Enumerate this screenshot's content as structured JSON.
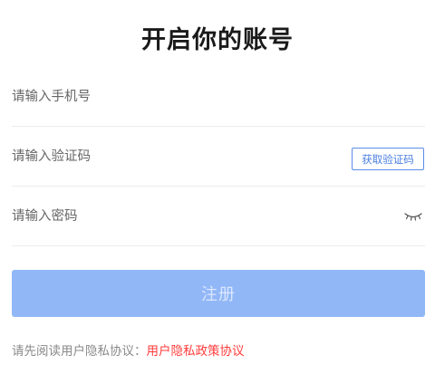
{
  "title": "开启你的账号",
  "fields": {
    "phone": {
      "placeholder": "请输入手机号",
      "value": ""
    },
    "code": {
      "placeholder": "请输入验证码",
      "value": "",
      "get_code_label": "获取验证码"
    },
    "password": {
      "placeholder": "请输入密码",
      "value": "",
      "toggle_icon": "eye-closed-icon"
    }
  },
  "register_label": "注册",
  "agreement": {
    "prefix": "请先阅读用户隐私协议：",
    "link": "用户隐私政策协议"
  },
  "colors": {
    "accent": "#4a7fe0",
    "button_disabled": "#91b7f7",
    "link": "#ff3b3b"
  }
}
